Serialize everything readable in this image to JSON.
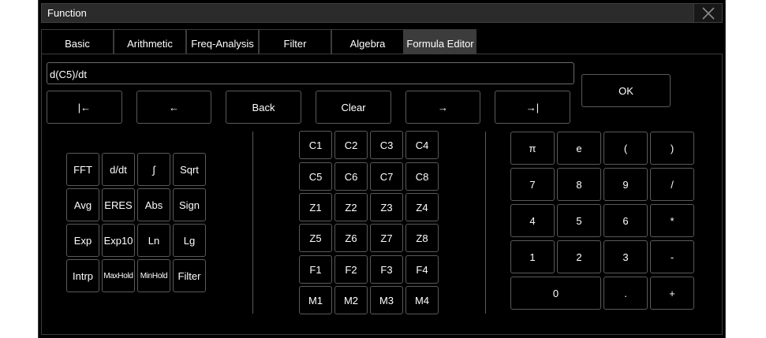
{
  "window": {
    "title": "Function"
  },
  "tabs": [
    {
      "label": "Basic"
    },
    {
      "label": "Arithmetic"
    },
    {
      "label": "Freq-Analysis"
    },
    {
      "label": "Filter"
    },
    {
      "label": "Algebra"
    },
    {
      "label": "Formula Editor",
      "active": true
    }
  ],
  "formula": {
    "value": "d(C5)/dt"
  },
  "ok_label": "OK",
  "nav_buttons": [
    "|←",
    "←",
    "Back",
    "Clear",
    "→",
    "→|"
  ],
  "functions": [
    [
      "FFT",
      "d/dt",
      "∫",
      "Sqrt"
    ],
    [
      "Avg",
      "ERES",
      "Abs",
      "Sign"
    ],
    [
      "Exp",
      "Exp10",
      "Ln",
      "Lg"
    ],
    [
      "Intrp",
      "MaxHold",
      "MinHold",
      "Filter"
    ]
  ],
  "sources": [
    [
      "C1",
      "C2",
      "C3",
      "C4"
    ],
    [
      "C5",
      "C6",
      "C7",
      "C8"
    ],
    [
      "Z1",
      "Z2",
      "Z3",
      "Z4"
    ],
    [
      "Z5",
      "Z6",
      "Z7",
      "Z8"
    ],
    [
      "F1",
      "F2",
      "F3",
      "F4"
    ],
    [
      "M1",
      "M2",
      "M3",
      "M4"
    ]
  ],
  "keypad": [
    [
      "π",
      "e",
      "(",
      ")"
    ],
    [
      "7",
      "8",
      "9",
      "/"
    ],
    [
      "4",
      "5",
      "6",
      "*"
    ],
    [
      "1",
      "2",
      "3",
      "-"
    ],
    [
      "0",
      ".",
      "+"
    ]
  ],
  "colors": {
    "background": "#000000",
    "tab_active": "#3c3c3c",
    "border": "#5a5a5a",
    "text": "#ffffff"
  }
}
